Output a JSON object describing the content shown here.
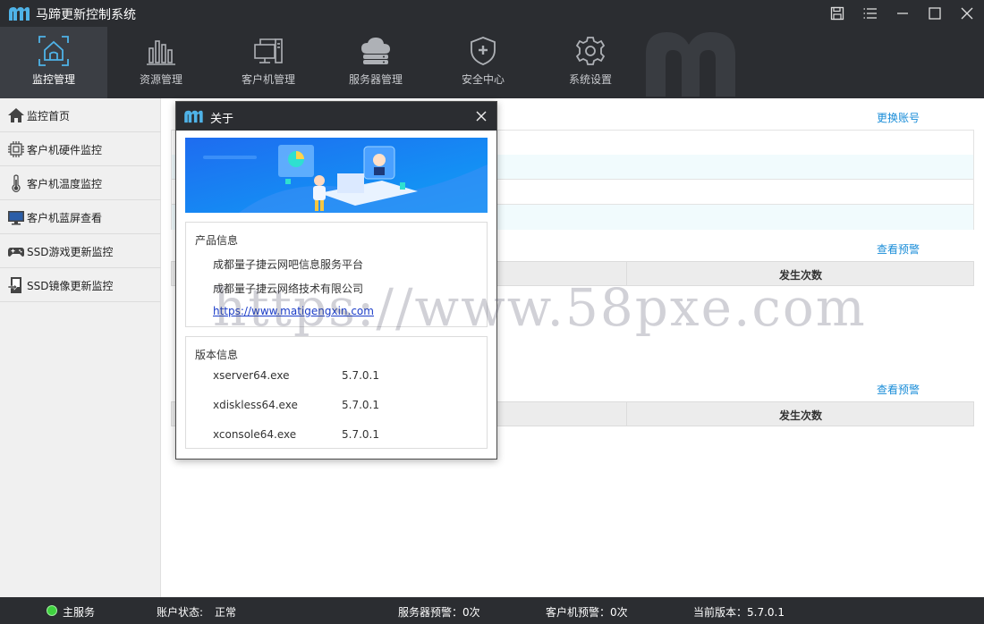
{
  "app": {
    "title": "马蹄更新控制系统",
    "accent": "#1a8dd8",
    "dark_bg": "#2b2d31"
  },
  "titlebar": {
    "icons": [
      "save-icon",
      "menu-icon",
      "minimize-icon",
      "maximize-icon",
      "close-icon"
    ]
  },
  "topnav": {
    "items": [
      {
        "label": "监控管理",
        "icon": "monitor-home-icon",
        "active": true
      },
      {
        "label": "资源管理",
        "icon": "bar-chart-icon"
      },
      {
        "label": "客户机管理",
        "icon": "computers-icon"
      },
      {
        "label": "服务器管理",
        "icon": "cloud-server-icon"
      },
      {
        "label": "安全中心",
        "icon": "shield-plus-icon"
      },
      {
        "label": "系统设置",
        "icon": "gear-icon"
      }
    ]
  },
  "sidebar": {
    "items": [
      {
        "label": "监控首页",
        "icon": "home-icon"
      },
      {
        "label": "客户机硬件监控",
        "icon": "chip-icon"
      },
      {
        "label": "客户机温度监控",
        "icon": "thermometer-icon"
      },
      {
        "label": "客户机蓝屏查看",
        "icon": "screen-icon"
      },
      {
        "label": "SSD游戏更新监控",
        "icon": "gamepad-icon"
      },
      {
        "label": "SSD镜像更新监控",
        "icon": "image-update-icon"
      }
    ]
  },
  "main": {
    "switch_account": "更换账号",
    "view_alert_1": "查看预警",
    "view_alert_2": "查看预警",
    "col_count_1": "发生次数",
    "col_count_2": "发生次数"
  },
  "watermark": "https://www.58pxe.com",
  "dialog": {
    "title": "关于",
    "product": {
      "title": "产品信息",
      "line1": "成都量子捷云网吧信息服务平台",
      "line2": "成都量子捷云网络技术有限公司",
      "link": "https://www.matigengxin.com"
    },
    "version": {
      "title": "版本信息",
      "rows": [
        {
          "name": "xserver64.exe",
          "version": "5.7.0.1"
        },
        {
          "name": "xdiskless64.exe",
          "version": "5.7.0.1"
        },
        {
          "name": "xconsole64.exe",
          "version": "5.7.0.1"
        }
      ]
    }
  },
  "statusbar": {
    "main_service": "主服务",
    "account_label": "账户状态:",
    "account_value": "正常",
    "server_alert": "服务器预警：0次",
    "client_alert": "客户机预警：0次",
    "version": "当前版本：5.7.0.1"
  }
}
